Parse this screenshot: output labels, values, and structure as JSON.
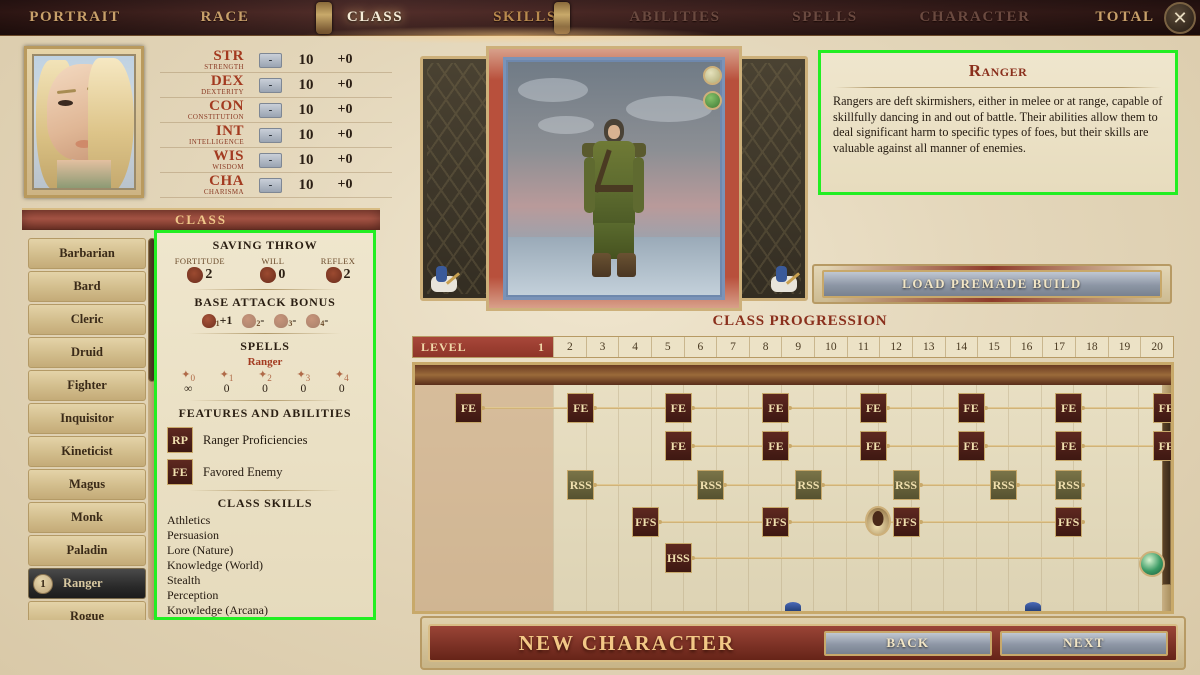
{
  "topnav": {
    "tabs": [
      {
        "label": "PORTRAIT",
        "state": "done"
      },
      {
        "label": "RACE",
        "state": "done"
      },
      {
        "label": "CLASS",
        "state": "active"
      },
      {
        "label": "SKILLS",
        "state": "next"
      },
      {
        "label": "ABILITIES",
        "state": "pending"
      },
      {
        "label": "SPELLS",
        "state": "pending"
      },
      {
        "label": "CHARACTER",
        "state": "pending"
      },
      {
        "label": "TOTAL",
        "state": "done"
      }
    ],
    "close_icon": "close-icon",
    "close_label": "✕"
  },
  "stats": [
    {
      "abbr": "STR",
      "full": "STRENGTH",
      "button": "-",
      "value": "10",
      "mod": "+0"
    },
    {
      "abbr": "DEX",
      "full": "DEXTERITY",
      "button": "-",
      "value": "10",
      "mod": "+0"
    },
    {
      "abbr": "CON",
      "full": "CONSTITUTION",
      "button": "-",
      "value": "10",
      "mod": "+0"
    },
    {
      "abbr": "INT",
      "full": "INTELLIGENCE",
      "button": "-",
      "value": "10",
      "mod": "+0"
    },
    {
      "abbr": "WIS",
      "full": "WISDOM",
      "button": "-",
      "value": "10",
      "mod": "+0"
    },
    {
      "abbr": "CHA",
      "full": "CHARISMA",
      "button": "-",
      "value": "10",
      "mod": "+0"
    }
  ],
  "class_panel": {
    "banner": "CLASS",
    "classes": [
      {
        "name": "Barbarian",
        "selected": false,
        "level": ""
      },
      {
        "name": "Bard",
        "selected": false,
        "level": ""
      },
      {
        "name": "Cleric",
        "selected": false,
        "level": ""
      },
      {
        "name": "Druid",
        "selected": false,
        "level": ""
      },
      {
        "name": "Fighter",
        "selected": false,
        "level": ""
      },
      {
        "name": "Inquisitor",
        "selected": false,
        "level": ""
      },
      {
        "name": "Kineticist",
        "selected": false,
        "level": ""
      },
      {
        "name": "Magus",
        "selected": false,
        "level": ""
      },
      {
        "name": "Monk",
        "selected": false,
        "level": ""
      },
      {
        "name": "Paladin",
        "selected": false,
        "level": ""
      },
      {
        "name": "Ranger",
        "selected": true,
        "level": "1"
      },
      {
        "name": "Rogue",
        "selected": false,
        "level": ""
      }
    ]
  },
  "detail": {
    "saving_throw_title": "SAVING THROW",
    "saves": [
      {
        "label": "FORTITUDE",
        "value": "2"
      },
      {
        "label": "WILL",
        "value": "0"
      },
      {
        "label": "REFLEX",
        "value": "2"
      }
    ],
    "bab_title": "BASE ATTACK BONUS",
    "bab": [
      {
        "index": "1",
        "value": "+1"
      },
      {
        "index": "2",
        "value": "-"
      },
      {
        "index": "3",
        "value": "-"
      },
      {
        "index": "4",
        "value": "-"
      }
    ],
    "spells_title": "SPELLS",
    "spells_class": "Ranger",
    "spell_levels": [
      "0",
      "1",
      "2",
      "3",
      "4"
    ],
    "spell_counts": [
      "∞",
      "0",
      "0",
      "0",
      "0"
    ],
    "features_title": "FEATURES AND ABILITIES",
    "features": [
      {
        "icon_text": "RP",
        "name": "Ranger Proficiencies"
      },
      {
        "icon_text": "FE",
        "name": "Favored Enemy"
      }
    ],
    "skills_title": "CLASS SKILLS",
    "skills": [
      "Athletics",
      "Persuasion",
      "Lore (Nature)",
      "Knowledge (World)",
      "Stealth",
      "Perception",
      "Knowledge (Arcana)"
    ]
  },
  "description": {
    "title": "Ranger",
    "body": "Rangers are deft skirmishers, either in melee or at range, capable of skillfully dancing in and out of battle. Their abilities allow them to deal significant harm to specific types of foes, but their skills are valuable against all manner of enemies."
  },
  "premade_button": "LOAD PREMADE BUILD",
  "progression": {
    "title": "CLASS PROGRESSION",
    "level_label": "LEVEL",
    "current_level": "1",
    "levels": [
      "2",
      "3",
      "4",
      "5",
      "6",
      "7",
      "8",
      "9",
      "10",
      "11",
      "12",
      "13",
      "14",
      "15",
      "16",
      "17",
      "18",
      "19",
      "20"
    ],
    "rows": [
      {
        "icon_text": "FE",
        "variant": "dark",
        "levels": [
          1,
          2,
          5,
          8,
          11,
          14,
          17,
          20
        ]
      },
      {
        "icon_text": "FE",
        "variant": "dark",
        "levels": [
          5,
          8,
          11,
          14,
          17,
          20
        ]
      },
      {
        "icon_text": "RSS",
        "variant": "olive",
        "levels": [
          2,
          6,
          9,
          12,
          15,
          17
        ]
      },
      {
        "icon_text": "FFS",
        "variant": "dark",
        "levels": [
          4,
          8,
          12,
          17
        ]
      },
      {
        "icon_text": "HSS",
        "variant": "dark",
        "levels": [
          5
        ]
      }
    ]
  },
  "bottom": {
    "title": "NEW CHARACTER",
    "back": "BACK",
    "next": "NEXT"
  }
}
